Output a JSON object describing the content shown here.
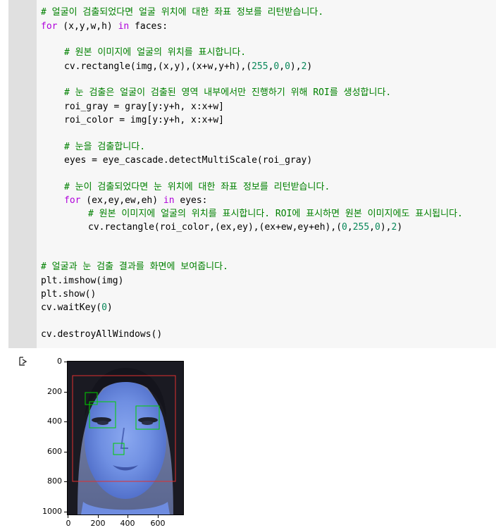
{
  "code": {
    "l1": "# 얼굴이 검출되었다면 얼굴 위치에 대한 좌표 정보를 리턴받습니다.",
    "l2_kw1": "for",
    "l2_a": " (x,y,w,h) ",
    "l2_kw2": "in",
    "l2_b": " faces:",
    "l3": "# 원본 이미지에 얼굴의 위치를 표시합니다.",
    "l4_a": "cv.rectangle(img,(x,y),(x+w,y+h),(",
    "l4_n1": "255",
    "l4_c1": ",",
    "l4_n2": "0",
    "l4_c2": ",",
    "l4_n3": "0",
    "l4_c3": "),",
    "l4_n4": "2",
    "l4_e": ")",
    "l5": "# 눈 검출은 얼굴이 검출된 영역 내부에서만 진행하기 위해 ROI를 생성합니다.",
    "l6": "roi_gray = gray[y:y+h, x:x+w]",
    "l7": "roi_color = img[y:y+h, x:x+w]",
    "l8": "# 눈을 검출합니다.",
    "l9": "eyes = eye_cascade.detectMultiScale(roi_gray)",
    "l10": "# 눈이 검출되었다면 눈 위치에 대한 좌표 정보를 리턴받습니다.",
    "l11_kw1": "for",
    "l11_a": " (ex,ey,ew,eh) ",
    "l11_kw2": "in",
    "l11_b": " eyes:",
    "l12": "# 원본 이미지에 얼굴의 위치를 표시합니다. ROI에 표시하면 원본 이미지에도 표시됩니다.",
    "l13_a": "cv.rectangle(roi_color,(ex,ey),(ex+ew,ey+eh),(",
    "l13_n1": "0",
    "l13_c1": ",",
    "l13_n2": "255",
    "l13_c2": ",",
    "l13_n3": "0",
    "l13_c3": "),",
    "l13_n4": "2",
    "l13_e": ")",
    "l14": "# 얼굴과 눈 검출 결과를 화면에 보여줍니다.",
    "l15": "plt.imshow(img)",
    "l16": "plt.show()",
    "l17_a": "cv.waitKey(",
    "l17_n": "0",
    "l17_e": ")",
    "l18": "cv.destroyAllWindows()"
  },
  "output": {
    "icon": "output-arrow-icon",
    "plot": {
      "yticks": [
        "0",
        "200",
        "400",
        "600",
        "800",
        "1000"
      ],
      "xticks": [
        "0",
        "200",
        "400",
        "600"
      ]
    }
  },
  "colors": {
    "comment": "#008000",
    "keyword": "#af00db",
    "number": "#09885a",
    "face_box": "#e03030",
    "eye_box": "#00d000"
  }
}
